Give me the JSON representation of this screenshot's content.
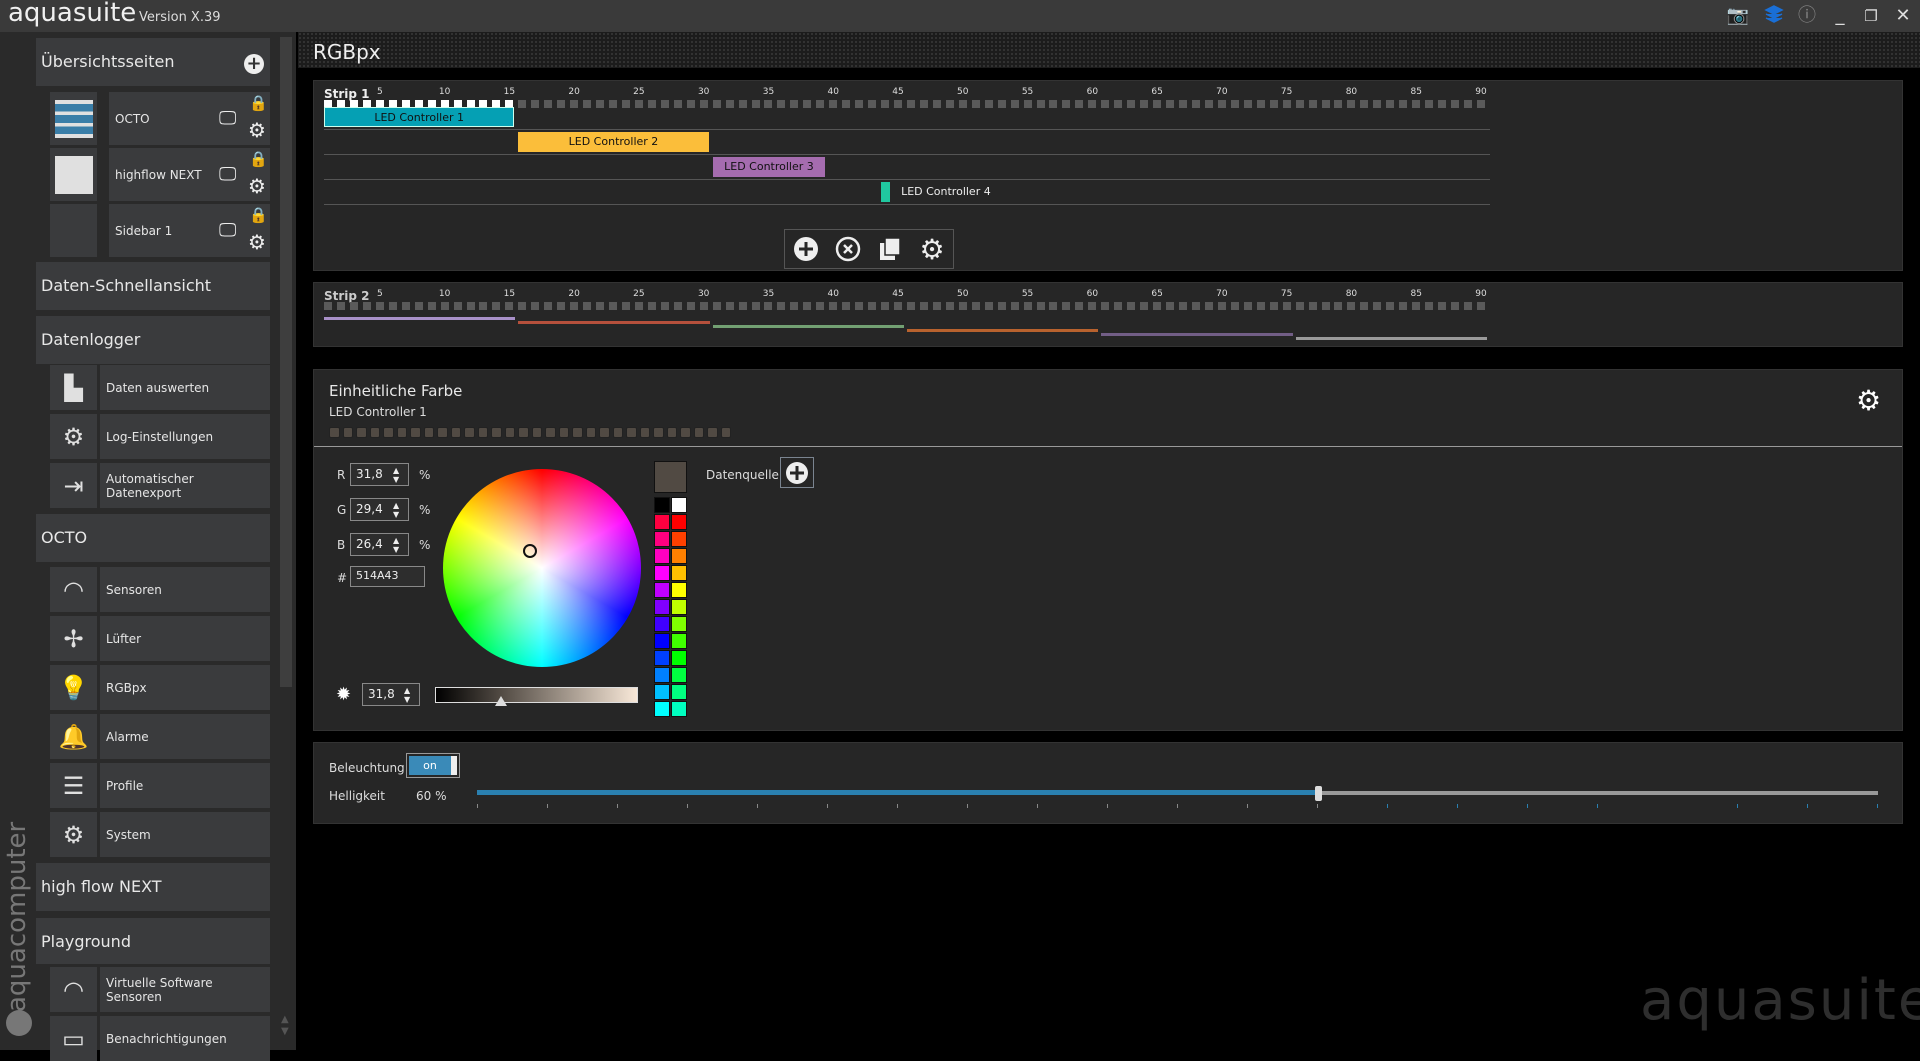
{
  "titlebar": {
    "app_name": "aquasuite",
    "version": "Version X.39",
    "icons": [
      "camera-add-icon",
      "layers-icon",
      "info-icon",
      "minimize-icon",
      "restore-icon",
      "close-icon"
    ]
  },
  "sidebar": {
    "overview_header": "Übersichtsseiten",
    "overview_pages": [
      {
        "label": "OCTO"
      },
      {
        "label": "highflow NEXT"
      },
      {
        "label": "Sidebar 1"
      }
    ],
    "sections": [
      {
        "type": "head",
        "label": "Daten-Schnellansicht"
      },
      {
        "type": "head",
        "label": "Datenlogger"
      },
      {
        "type": "item",
        "label": "Daten auswerten",
        "icon": "bar-chart-icon"
      },
      {
        "type": "item",
        "label": "Log-Einstellungen",
        "icon": "gear-icon"
      },
      {
        "type": "item",
        "label": "Automatischer Datenexport",
        "icon": "export-icon"
      },
      {
        "type": "head",
        "label": "OCTO"
      },
      {
        "type": "item",
        "label": "Sensoren",
        "icon": "gauge-icon"
      },
      {
        "type": "item",
        "label": "Lüfter",
        "icon": "fan-icon"
      },
      {
        "type": "item",
        "label": "RGBpx",
        "icon": "lightbulb-icon",
        "active": true
      },
      {
        "type": "item",
        "label": "Alarme",
        "icon": "alarm-bell-icon"
      },
      {
        "type": "item",
        "label": "Profile",
        "icon": "layers-icon"
      },
      {
        "type": "item",
        "label": "System",
        "icon": "gear-icon"
      },
      {
        "type": "head",
        "label": "high flow NEXT"
      },
      {
        "type": "head",
        "label": "Playground"
      },
      {
        "type": "item",
        "label": "Virtuelle Software Sensoren",
        "icon": "gauge-icon"
      },
      {
        "type": "item",
        "label": "Benachrichtigungen",
        "icon": "message-icon"
      }
    ],
    "brand": "aquacomputer"
  },
  "main": {
    "title": "RGBpx",
    "strip1": {
      "label": "Strip 1",
      "led_count": 90,
      "active_leds": 15,
      "controllers": [
        {
          "label": "LED Controller 1",
          "start": 1,
          "end": 15,
          "color": "#05a0b4"
        },
        {
          "label": "LED Controller 2",
          "start": 16,
          "end": 30,
          "color": "#fbbe3a"
        },
        {
          "label": "LED Controller 3",
          "start": 31,
          "end": 39,
          "color": "#a56caf"
        },
        {
          "label": "LED Controller 4",
          "start": 44,
          "end": 44,
          "color": "#20c8a0"
        }
      ]
    },
    "strip2": {
      "label": "Strip 2",
      "led_count": 90,
      "segments": [
        {
          "start": 1,
          "end": 15,
          "color": "#a890c8"
        },
        {
          "start": 16,
          "end": 30,
          "color": "#b5503c"
        },
        {
          "start": 31,
          "end": 45,
          "color": "#72a072"
        },
        {
          "start": 46,
          "end": 60,
          "color": "#b8622e"
        },
        {
          "start": 61,
          "end": 75,
          "color": "#725e86"
        },
        {
          "start": 76,
          "end": 90,
          "color": "#9a9a9a"
        }
      ]
    },
    "tick_labels": [
      "5",
      "10",
      "15",
      "20",
      "25",
      "30",
      "35",
      "40",
      "45",
      "50",
      "55",
      "60",
      "65",
      "70",
      "75",
      "80",
      "85",
      "90"
    ],
    "color_panel": {
      "title": "Einheitliche Farbe",
      "subtitle": "LED Controller 1",
      "led_dots": 30,
      "r_label": "R",
      "r": "31,8",
      "g_label": "G",
      "g": "29,4",
      "b_label": "B",
      "b": "26,4",
      "unit": "%",
      "hex_label": "#",
      "hex": "514A43",
      "current_color": "#514a43",
      "brightness": "31,8",
      "brightness_fraction": 0.318,
      "datasource_label": "Datenquelle",
      "palette": [
        [
          "#000000",
          "#ffffff"
        ],
        [
          "#ff0040",
          "#ff0000"
        ],
        [
          "#ff0080",
          "#ff4000"
        ],
        [
          "#ff00c0",
          "#ff8000"
        ],
        [
          "#ff00ff",
          "#ffc000"
        ],
        [
          "#c000ff",
          "#ffff00"
        ],
        [
          "#8000ff",
          "#c0ff00"
        ],
        [
          "#4000ff",
          "#80ff00"
        ],
        [
          "#0000ff",
          "#40ff00"
        ],
        [
          "#0040ff",
          "#00ff00"
        ],
        [
          "#0080ff",
          "#00ff40"
        ],
        [
          "#00c0ff",
          "#00ff80"
        ],
        [
          "#00ffff",
          "#00ffc0"
        ]
      ]
    },
    "lighting": {
      "label": "Beleuchtung",
      "toggle": "on",
      "brightness_label": "Helligkeit",
      "brightness_value": "60 %",
      "brightness_fraction": 0.6
    },
    "watermark": "aquasuite"
  }
}
